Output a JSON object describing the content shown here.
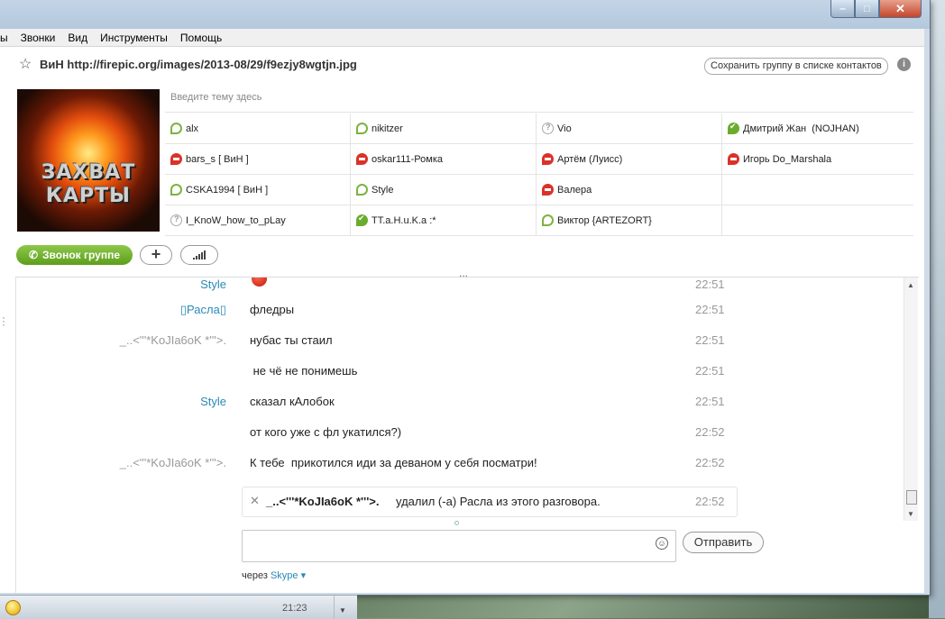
{
  "window": {
    "minimize_glyph": "‒",
    "maximize_glyph": "□",
    "close_glyph": "✕"
  },
  "menu": [
    "ы",
    "Звонки",
    "Вид",
    "Инструменты",
    "Помощь"
  ],
  "conversation": {
    "title": "ВиН http://firepic.org/images/2013-08/29/f9ezjy8wgtjn.jpg",
    "save_group_label": "Сохранить группу в списке контактов",
    "topic_placeholder": "Введите тему здесь",
    "image_text_line1": "ЗАХВАТ",
    "image_text_line2": "КАРТЫ"
  },
  "participants": [
    [
      {
        "name": "alx",
        "status": "online"
      },
      {
        "name": "nikitzer",
        "status": "online"
      },
      {
        "name": "Vio",
        "status": "unknown"
      },
      {
        "name": "Дмитрий Жан  (NOJHAN)",
        "status": "online-check"
      }
    ],
    [
      {
        "name": "bars_s [ ВиН ]",
        "status": "dnd"
      },
      {
        "name": "oskar111-Ромка",
        "status": "dnd"
      },
      {
        "name": "Артём (Луисс)",
        "status": "dnd"
      },
      {
        "name": "Игорь Do_Marshala",
        "status": "dnd"
      }
    ],
    [
      {
        "name": "CSKA1994 [ ВиН ]",
        "status": "online"
      },
      {
        "name": "Style",
        "status": "online"
      },
      {
        "name": "Валера",
        "status": "dnd"
      },
      {
        "name": "",
        "status": "none"
      }
    ],
    [
      {
        "name": "I_KnoW_how_to_pLay",
        "status": "unknown"
      },
      {
        "name": "TT.a.H.u.K.a :*",
        "status": "online-check"
      },
      {
        "name": "Виктор {ARTEZORT}",
        "status": "online"
      },
      {
        "name": "",
        "status": "none"
      }
    ]
  ],
  "actions": {
    "call_group_label": "Звонок группе",
    "add_label": "+",
    "expand_label": "..."
  },
  "messages": [
    {
      "sender": "Style",
      "sender_kind": "style",
      "text": "",
      "time": "22:51",
      "emoticon": "mad"
    },
    {
      "sender": "Расла",
      "sender_kind": "style",
      "text": "фледры",
      "time": "22:51"
    },
    {
      "sender": "_..<'''*KoJIa6oK *'''>.",
      "sender_kind": "other",
      "text": "нубас ты стаил",
      "time": "22:51"
    },
    {
      "sender": "",
      "sender_kind": "other",
      "text": " не чё не понимешь",
      "time": "22:51"
    },
    {
      "sender": "Style",
      "sender_kind": "style",
      "text": "сказал кАлобок",
      "time": "22:51"
    },
    {
      "sender": "",
      "sender_kind": "other",
      "text": "от кого уже с фл укатился?)",
      "time": "22:52"
    },
    {
      "sender": "_..<'''*KoJIa6oK *'''>.",
      "sender_kind": "other",
      "text": "К тебе  прикотился иди за деваном у себя посматри!",
      "time": "22:52"
    }
  ],
  "system_message": {
    "close_glyph": "✕",
    "who": "_..<'''*KoJIa6oK *'''>.",
    "what": "удалил (-а) Расла из этого разговора.",
    "time": "22:52"
  },
  "compose": {
    "value": "",
    "placeholder": "",
    "smile_glyph": "☺",
    "send_label": "Отправить",
    "via_prefix": "через",
    "via_link": "Skype ▾"
  },
  "taskbar": {
    "time": "21:23"
  }
}
